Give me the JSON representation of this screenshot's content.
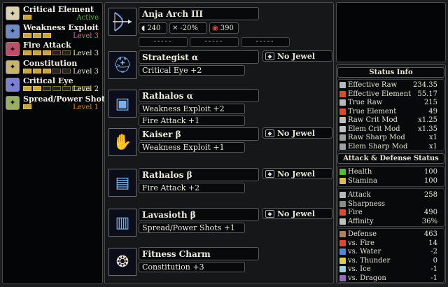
{
  "skills_panel": {
    "items": [
      {
        "name": "Critical Element",
        "level": "Active",
        "level_color": "#4fc02a",
        "pips": 1,
        "pips_on": 1,
        "icon": "element-crit-icon",
        "icon_color": "#d9d2b0"
      },
      {
        "name": "Weakness Exploit",
        "level": "Level 3",
        "level_color": "#d8822a",
        "pips": 3,
        "pips_on": 3,
        "icon": "weakness-icon",
        "icon_color": "#6d8bc9"
      },
      {
        "name": "Fire Attack",
        "level": "Level 3",
        "level_color": "#f0ece0",
        "pips": 5,
        "pips_on": 3,
        "icon": "fire-attack-icon",
        "icon_color": "#c44a6a"
      },
      {
        "name": "Constitution",
        "level": "Level 3",
        "level_color": "#f0ece0",
        "pips": 5,
        "pips_on": 3,
        "icon": "constitution-icon",
        "icon_color": "#c8b46e"
      },
      {
        "name": "Critical Eye",
        "level": "Level 2",
        "level_color": "#f0ece0",
        "pips": 7,
        "pips_on": 2,
        "icon": "critical-eye-icon",
        "icon_color": "#7a7fd8"
      },
      {
        "name": "Spread/Power Shots",
        "level": "Level 1",
        "level_color": "#d8822a",
        "pips": 1,
        "pips_on": 1,
        "icon": "shots-icon",
        "icon_color": "#9ab060"
      }
    ]
  },
  "weapon": {
    "name": "Anja Arch III",
    "attack": "240",
    "affinity": "-20%",
    "element": "390",
    "slots": [
      "-----",
      "-----",
      "-----"
    ]
  },
  "armor": [
    {
      "name": "Strategist α",
      "jewel": "No Jewel",
      "skills": [
        "Critical Eye +2"
      ],
      "icon": "helm-icon"
    },
    {
      "name": "Rathalos α",
      "jewel": "",
      "skills": [
        "Weakness Exploit +2",
        "Fire Attack +1"
      ],
      "icon": "chest-icon"
    },
    {
      "name": "Kaiser β",
      "jewel": "No Jewel",
      "skills": [
        "Weakness Exploit +1"
      ],
      "icon": "arms-icon"
    },
    {
      "name": "Rathalos β",
      "jewel": "No Jewel",
      "skills": [
        "Fire Attack +2"
      ],
      "icon": "waist-icon"
    },
    {
      "name": "Lavasioth β",
      "jewel": "No Jewel",
      "skills": [
        "Spread/Power Shots +1"
      ],
      "icon": "legs-icon"
    },
    {
      "name": "Fitness Charm",
      "jewel": "",
      "skills": [
        "Constitution +3"
      ],
      "icon": "charm-icon"
    }
  ],
  "status": {
    "title": "Status Info",
    "rows": [
      {
        "label": "Effective Raw",
        "value": "234.35",
        "color": "#b8b8b8"
      },
      {
        "label": "Effective Element",
        "value": "55.17",
        "color": "#e04a2a"
      },
      {
        "label": "True Raw",
        "value": "215",
        "color": "#b8b8b8"
      },
      {
        "label": "True Element",
        "value": "49",
        "color": "#e04a2a"
      },
      {
        "label": "Raw Crit Mod",
        "value": "x1.25",
        "color": "#c0c0c0"
      },
      {
        "label": "Elem Crit Mod",
        "value": "x1.35",
        "color": "#c0c0c0"
      },
      {
        "label": "Raw Sharp Mod",
        "value": "x1",
        "color": "#a0a0a0"
      },
      {
        "label": "Elem Sharp Mod",
        "value": "x1",
        "color": "#a0a0a0"
      }
    ],
    "ad_title": "Attack & Defense Status",
    "vitals": [
      {
        "label": "Health",
        "value": "100",
        "color": "#4fc02a"
      },
      {
        "label": "Stamina",
        "value": "100",
        "color": "#e0c040"
      }
    ],
    "attack": [
      {
        "label": "Attack",
        "value": "258",
        "color": "#b8b8b8"
      },
      {
        "label": "Sharpness",
        "value": "",
        "color": "#8a8a8a"
      },
      {
        "label": "Fire",
        "value": "490",
        "color": "#e04a2a"
      },
      {
        "label": "Affinity",
        "value": "36%",
        "color": "#c0c0c0"
      }
    ],
    "defense": [
      {
        "label": "Defense",
        "value": "463",
        "color": "#b08060"
      },
      {
        "label": "vs. Fire",
        "value": "14",
        "color": "#e04a2a"
      },
      {
        "label": "vs. Water",
        "value": "-2",
        "color": "#4a8ae0"
      },
      {
        "label": "vs. Thunder",
        "value": "0",
        "color": "#e0d040"
      },
      {
        "label": "vs. Ice",
        "value": "-1",
        "color": "#9ad0e0"
      },
      {
        "label": "vs. Dragon",
        "value": "-1",
        "color": "#9a6ac0"
      }
    ]
  }
}
